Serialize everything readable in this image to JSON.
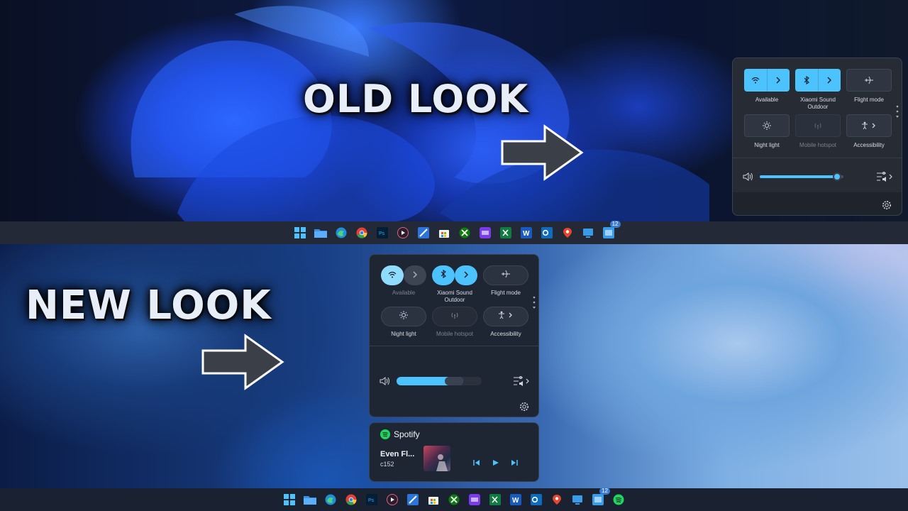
{
  "headlines": {
    "old": "OLD LOOK",
    "new": "NEW LOOK"
  },
  "quick_settings": {
    "wifi_label": "Available",
    "bluetooth_label": "Xiaomi Sound Outdoor",
    "flight_label": "Flight mode",
    "night_label": "Night light",
    "hotspot_label": "Mobile hotspot",
    "accessibility_label": "Accessibility",
    "old_volume_level": 0.92,
    "new_volume_level": 0.78
  },
  "media": {
    "app": "Spotify",
    "track": "Even Fl...",
    "artist": "c152"
  },
  "taskbar": {
    "badge": "12"
  },
  "colors": {
    "accent": "#4cc2ff",
    "spotify": "#1ed760"
  },
  "icons": [
    "windows-icon",
    "file-explorer-icon",
    "edge-icon",
    "chrome-icon",
    "photoshop-icon",
    "media-player-icon",
    "snip-icon",
    "store-icon",
    "xbox-icon",
    "clipchamp-icon",
    "excel-icon",
    "word-icon",
    "outlook-icon",
    "maps-icon",
    "remote-desktop-icon",
    "teams-icon",
    "spotify-icon"
  ]
}
